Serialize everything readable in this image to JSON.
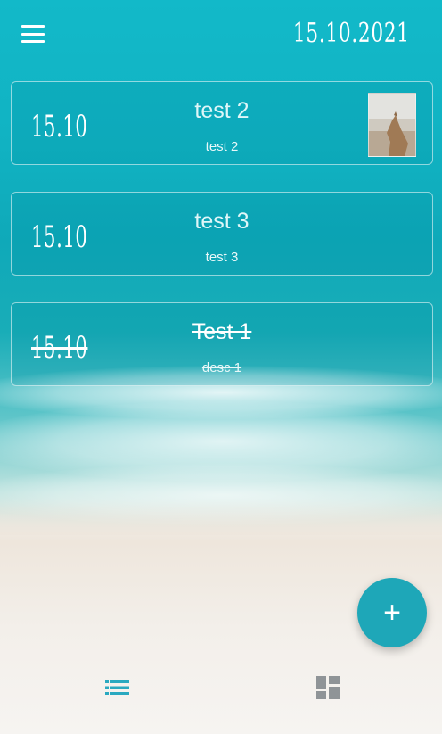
{
  "header": {
    "date": "15.10.2021",
    "menu_icon": "menu-icon"
  },
  "notes": [
    {
      "date": "15.10",
      "title": "test 2",
      "description": "test 2",
      "has_image": true,
      "completed": false
    },
    {
      "date": "15.10",
      "title": "test 3",
      "description": "test 3",
      "has_image": false,
      "completed": false
    },
    {
      "date": "15.10",
      "title": "Test 1",
      "description": "desc 1",
      "has_image": false,
      "completed": true
    }
  ],
  "fab": {
    "icon": "plus-icon",
    "label": "+"
  },
  "bottom_nav": {
    "items": [
      {
        "icon": "list-icon",
        "active": true,
        "color": "#2aa9c0"
      },
      {
        "icon": "grid-icon",
        "active": false,
        "color": "#8f9497"
      }
    ]
  },
  "colors": {
    "accent": "#1ea7b8"
  }
}
